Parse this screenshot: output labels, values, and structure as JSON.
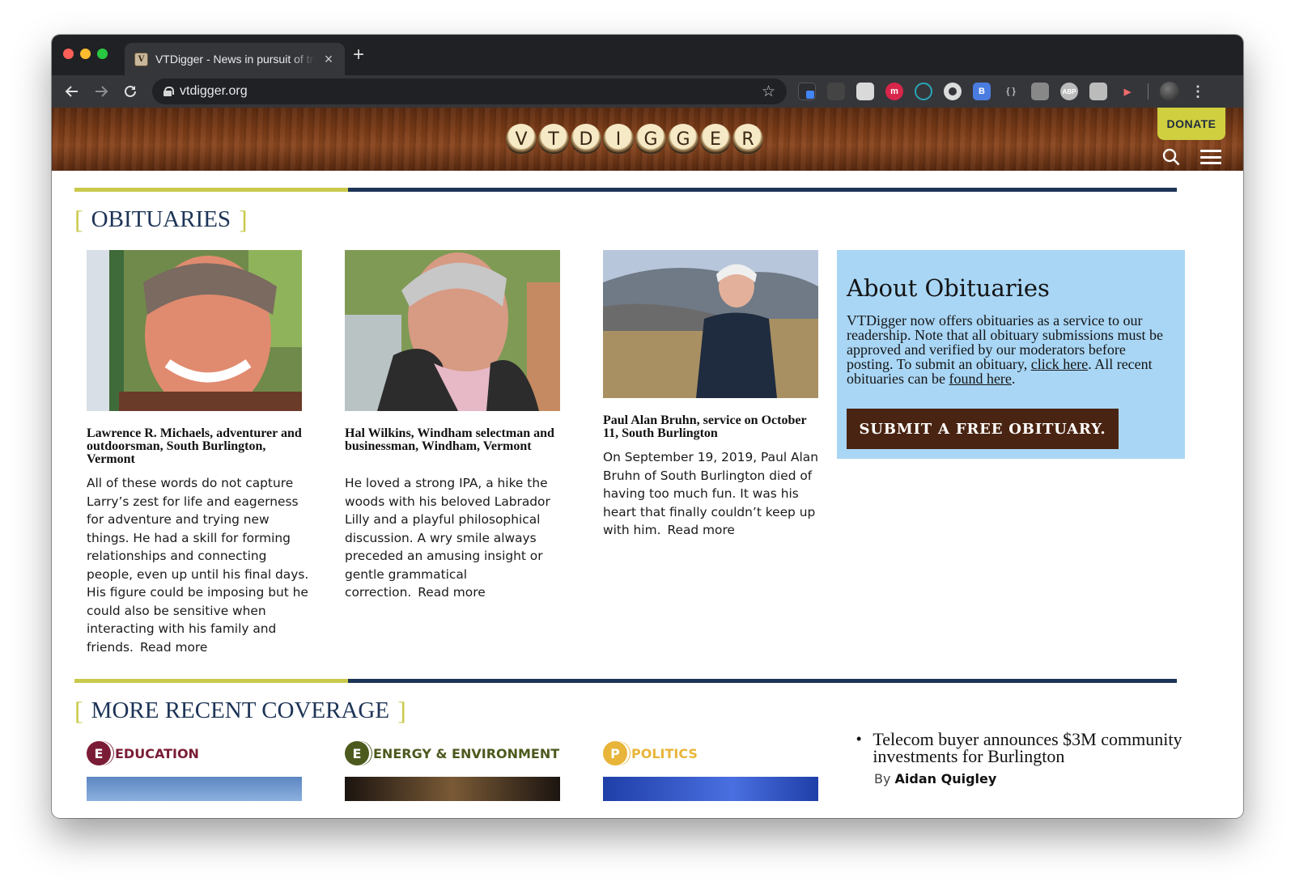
{
  "browser": {
    "tab_title": "VTDigger - News in pursuit of truth",
    "tab_close": "×",
    "new_tab": "+",
    "url": "vtdigger.org",
    "favicon_letter": "V"
  },
  "site": {
    "logo_letters": [
      "V",
      "T",
      "D",
      "I",
      "G",
      "G",
      "E",
      "R"
    ],
    "donate_label": "DONATE"
  },
  "obituaries": {
    "section_title": "OBITUARIES",
    "items": [
      {
        "title": "Lawrence R. Michaels, adventurer and outdoorsman, South Burlington, Vermont",
        "summary": "All of these words do not capture Larry’s zest for life and eagerness for adventure and trying new things. He had a skill for forming relationships and connecting people, even up until his final days. His figure could be imposing but he could also be sensitive when interacting with his family and friends.",
        "read_more": "Read more"
      },
      {
        "title": "Hal Wilkins, Windham selectman and businessman, Windham, Vermont",
        "summary": "He loved a strong IPA, a hike the woods with his beloved Labrador Lilly and a playful philosophical discussion.  A wry smile always preceded an amusing insight or gentle grammatical correction.",
        "read_more": "Read more"
      },
      {
        "title": "Paul Alan Bruhn, service on October 11, South Burlington",
        "summary": "On September 19, 2019, Paul Alan Bruhn of South Burlington died of having too much fun. It was his heart that finally couldn’t keep up with him.",
        "read_more": "Read more"
      }
    ]
  },
  "about": {
    "heading": "About Obituaries",
    "text_1": "VTDigger now offers obituaries as a service to our readership. Note that all obituary submissions must be approved and verified by our moderators before posting. To submit an obituary, ",
    "link_1": "click here",
    "text_2": ". All recent obituaries can be ",
    "link_2": "found here",
    "text_3": ".",
    "button_label": "SUBMIT A FREE OBITUARY."
  },
  "recent": {
    "section_title": "MORE RECENT COVERAGE",
    "categories": [
      {
        "badge": "E",
        "label": "EDUCATION",
        "color": "#7a1c35"
      },
      {
        "badge": "E",
        "label": "ENERGY & ENVIRONMENT",
        "color": "#4c5a1e"
      },
      {
        "badge": "P",
        "label": "POLITICS",
        "color": "#e8b53a"
      }
    ],
    "headline": "Telecom buyer announces $3M community investments for Burlington",
    "byline_prefix": "By",
    "byline_author": "Aidan Quigley"
  },
  "colors": {
    "accent_olive": "#c9c94d",
    "navy": "#1d3457",
    "about_bg": "#a9d6f5",
    "button_brown": "#4a2412"
  }
}
